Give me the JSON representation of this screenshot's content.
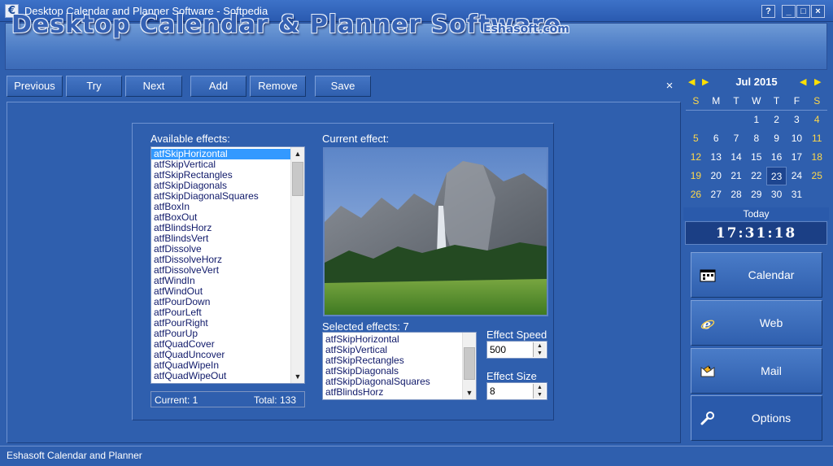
{
  "window": {
    "title": "Desktop Calendar and Planner Software - Softpedia"
  },
  "header": {
    "title": "Desktop Calendar & Planner Software",
    "site": "Eshasoft.com"
  },
  "toolbar": {
    "previous": "Previous",
    "try": "Try",
    "next": "Next",
    "add": "Add",
    "remove": "Remove",
    "save": "Save",
    "close": "×"
  },
  "effects": {
    "available_label": "Available effects:",
    "available": [
      "atfSkipHorizontal",
      "atfSkipVertical",
      "atfSkipRectangles",
      "atfSkipDiagonals",
      "atfSkipDiagonalSquares",
      "atfBoxIn",
      "atfBoxOut",
      "atfBlindsHorz",
      "atfBlindsVert",
      "atfDissolve",
      "atfDissolveHorz",
      "atfDissolveVert",
      "atfWindIn",
      "atfWindOut",
      "atfPourDown",
      "atfPourLeft",
      "atfPourRight",
      "atfPourUp",
      "atfQuadCover",
      "atfQuadUncover",
      "atfQuadWipeIn",
      "atfQuadWipeOut"
    ],
    "current_label": "Current effect:",
    "selected_label": "Selected effects: 7",
    "selected": [
      "atfSkipHorizontal",
      "atfSkipVertical",
      "atfSkipRectangles",
      "atfSkipDiagonals",
      "atfSkipDiagonalSquares",
      "atfBlindsHorz"
    ],
    "speed_label": "Effect Speed",
    "speed_value": "500",
    "size_label": "Effect Size",
    "size_value": "8",
    "current_status": "Current: 1",
    "total_status": "Total: 133"
  },
  "calendar": {
    "month": "Jul 2015",
    "weekdays": [
      "S",
      "M",
      "T",
      "W",
      "T",
      "F",
      "S"
    ],
    "weeks": [
      [
        "",
        "",
        "",
        "1",
        "2",
        "3",
        "4"
      ],
      [
        "5",
        "6",
        "7",
        "8",
        "9",
        "10",
        "11"
      ],
      [
        "12",
        "13",
        "14",
        "15",
        "16",
        "17",
        "18"
      ],
      [
        "19",
        "20",
        "21",
        "22",
        "23",
        "24",
        "25"
      ],
      [
        "26",
        "27",
        "28",
        "29",
        "30",
        "31",
        ""
      ]
    ],
    "today_day": "23",
    "today_label": "Today",
    "clock": "17:31:18"
  },
  "side": {
    "calendar": "Calendar",
    "web": "Web",
    "mail": "Mail",
    "options": "Options"
  },
  "status": {
    "text": "Eshasoft Calendar and Planner"
  }
}
